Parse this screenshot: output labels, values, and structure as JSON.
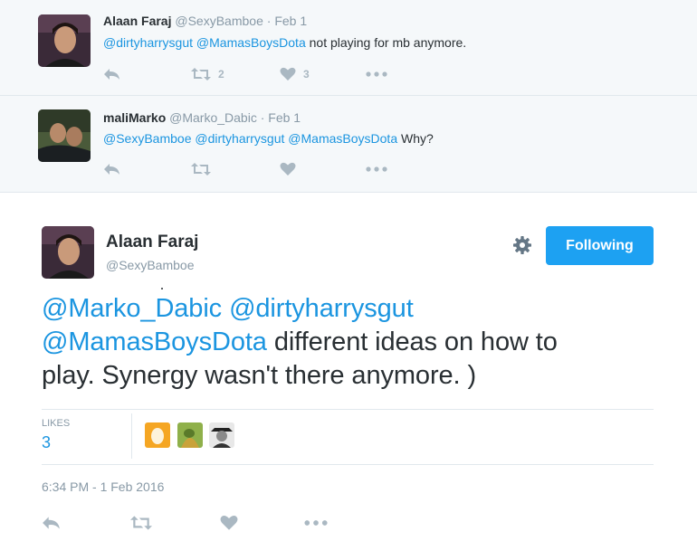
{
  "thread": [
    {
      "fullname": "Alaan Faraj",
      "handle": "@SexyBamboe",
      "separator": "·",
      "time": "Feb 1",
      "mentions": [
        "@dirtyharrysgut",
        "@MamasBoysDota"
      ],
      "text": "not playing for mb anymore.",
      "retweets": "2",
      "likes": "3"
    },
    {
      "fullname": "maliMarko",
      "handle": "@Marko_Dabic",
      "separator": "·",
      "time": "Feb 1",
      "mentions": [
        "@SexyBamboe",
        "@dirtyharrysgut",
        "@MamasBoysDota"
      ],
      "text": "Why?"
    }
  ],
  "main_tweet": {
    "fullname": "Alaan Faraj",
    "handle": "@SexyBamboe",
    "follow_label": "Following",
    "mentions": [
      "@Marko_Dabic",
      "@dirtyharrysgut",
      "@MamasBoysDota"
    ],
    "text_line2_rest": "different ideas on how to",
    "text_line3": "play. Synergy wasn't there anymore. )",
    "likes_label": "LIKES",
    "likes_count": "3",
    "timestamp": "6:34 PM - 1 Feb 2016"
  },
  "icons": {
    "reply": "reply-icon",
    "retweet": "retweet-icon",
    "like": "heart-icon",
    "more": "more-icon",
    "settings": "gear-icon"
  },
  "colors": {
    "accent": "#1da1f2",
    "link": "#1b95e0",
    "muted": "#8899a6",
    "icon": "#aab8c2",
    "ancestor_bg": "#f5f8fa"
  }
}
